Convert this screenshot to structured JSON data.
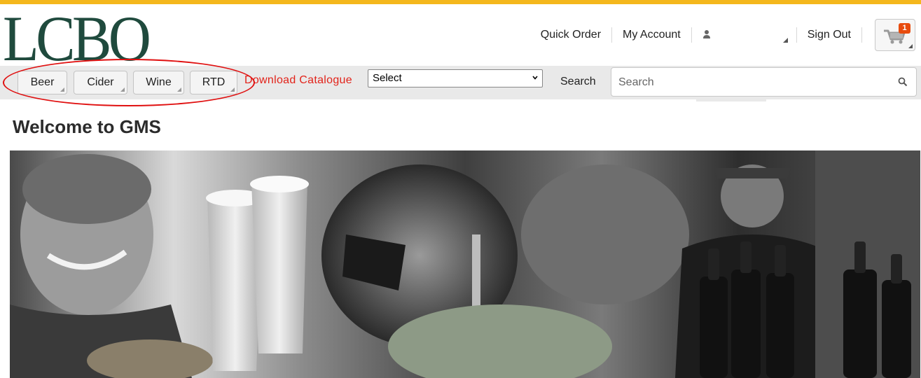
{
  "logo": {
    "text": "LCBO"
  },
  "top_nav": {
    "quick_order": "Quick Order",
    "my_account": "My Account",
    "sign_out": "Sign Out",
    "cart_count": "1"
  },
  "nav": {
    "categories": [
      "Beer",
      "Cider",
      "Wine",
      "RTD"
    ],
    "download_catalogue": "Download Catalogue",
    "select_value": "Select",
    "search_label": "Search",
    "search_placeholder": "Search"
  },
  "main": {
    "title": "Welcome to GMS"
  },
  "hero": {
    "description_icon": "banner-image"
  },
  "colors": {
    "brand_green": "#1f4a3d",
    "top_accent": "#f4b71c",
    "download_red": "#e2231a",
    "cart_badge": "#e84c0e",
    "annotation_red": "#e01010"
  }
}
